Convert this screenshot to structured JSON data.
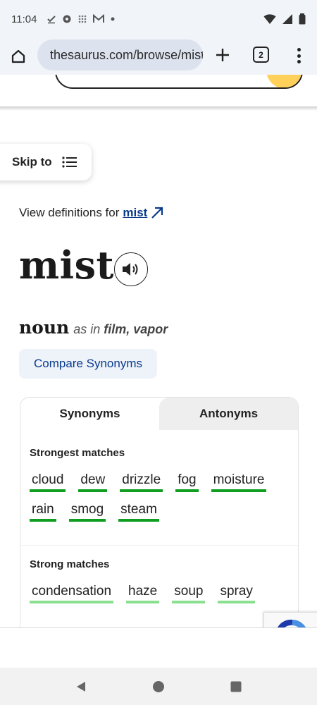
{
  "status_bar": {
    "time": "11:04"
  },
  "browser": {
    "url": "thesaurus.com/browse/mist",
    "tab_count": "2"
  },
  "page": {
    "skip_to_label": "Skip to",
    "view_definitions_prefix": "View definitions for",
    "view_definitions_link": "mist",
    "headword": "mist",
    "part_of_speech": "noun",
    "as_in_label": "as in",
    "as_in_words": "film, vapor",
    "compare_button": "Compare Synonyms",
    "tabs": [
      {
        "label": "Synonyms",
        "active": true
      },
      {
        "label": "Antonyms",
        "active": false
      }
    ],
    "strongest_matches": {
      "title": "Strongest matches",
      "words": [
        "cloud",
        "dew",
        "drizzle",
        "fog",
        "moisture",
        "rain",
        "smog",
        "steam"
      ]
    },
    "strong_matches": {
      "title": "Strong matches",
      "words": [
        "condensation",
        "haze",
        "soup",
        "spray"
      ]
    }
  },
  "colors": {
    "link_blue": "#0a3a8c",
    "strongest_underline": "#0f9e22",
    "strong_underline": "#8be08f",
    "search_button": "#ffd15b"
  }
}
